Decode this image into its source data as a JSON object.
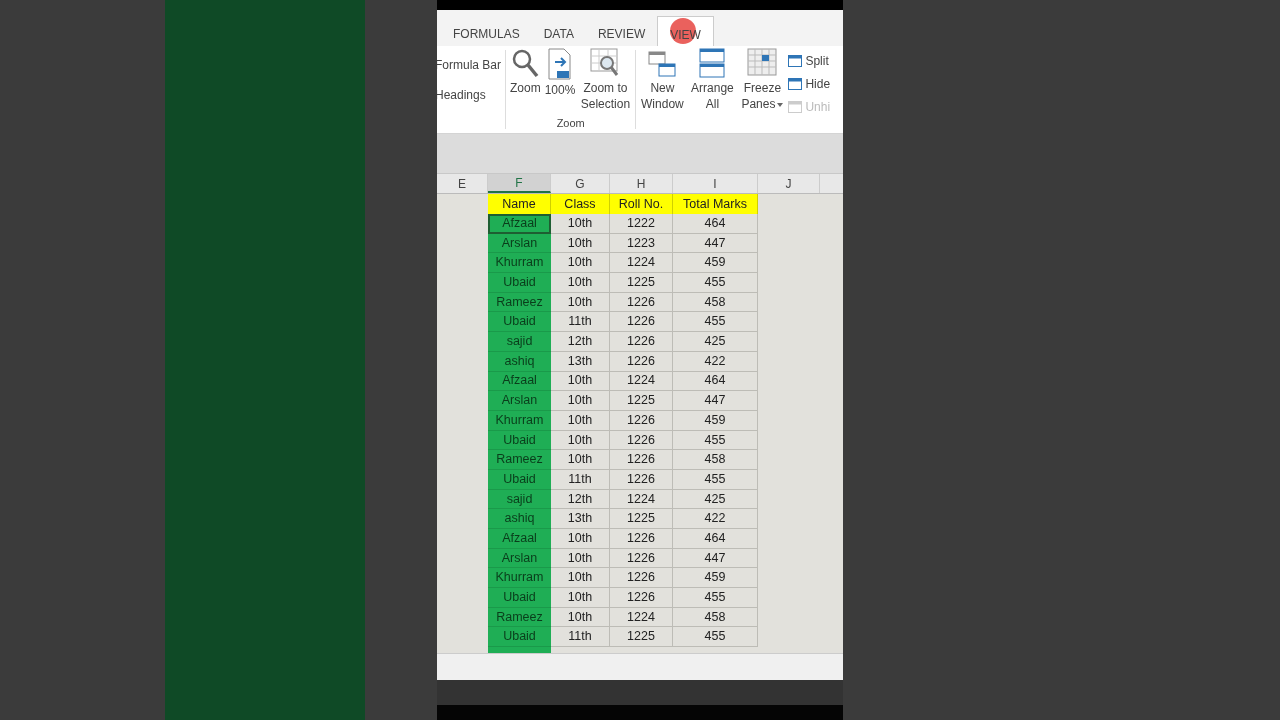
{
  "ribbon_tabs": [
    {
      "label": "FORMULAS",
      "selected": false
    },
    {
      "label": "DATA",
      "selected": false
    },
    {
      "label": "REVIEW",
      "selected": false
    },
    {
      "label": "VIEW",
      "selected": true
    }
  ],
  "show_options": [
    "Formula Bar",
    "Headings"
  ],
  "zoom_group": {
    "buttons": [
      {
        "kind": "zoom",
        "label": "Zoom"
      },
      {
        "kind": "hundred",
        "label": "100%"
      },
      {
        "kind": "selection",
        "label": "Zoom to Selection"
      }
    ],
    "label": "Zoom"
  },
  "window_group": {
    "buttons": [
      {
        "kind": "new",
        "label": "New Window"
      },
      {
        "kind": "arrange",
        "label": "Arrange All"
      },
      {
        "kind": "freeze",
        "label": "Freeze Panes",
        "dropdown": true
      }
    ],
    "small_buttons": [
      {
        "label": "Split",
        "disabled": false
      },
      {
        "label": "Hide",
        "disabled": false
      },
      {
        "label": "Unhi",
        "disabled": true
      }
    ]
  },
  "columns": [
    {
      "label": "E",
      "selected": false
    },
    {
      "label": "F",
      "selected": true
    },
    {
      "label": "G",
      "selected": false
    },
    {
      "label": "H",
      "selected": false
    },
    {
      "label": "I",
      "selected": false
    },
    {
      "label": "J",
      "selected": false
    }
  ],
  "table": {
    "headers": [
      "Name",
      "Class",
      "Roll No.",
      "Total Marks"
    ],
    "rows": [
      {
        "name": "Afzaal",
        "class": "10th",
        "roll": "1222",
        "marks": "464",
        "selected": true
      },
      {
        "name": "Arslan",
        "class": "10th",
        "roll": "1223",
        "marks": "447",
        "selected": false
      },
      {
        "name": "Khurram",
        "class": "10th",
        "roll": "1224",
        "marks": "459",
        "selected": false
      },
      {
        "name": "Ubaid",
        "class": "10th",
        "roll": "1225",
        "marks": "455",
        "selected": false
      },
      {
        "name": "Rameez",
        "class": "10th",
        "roll": "1226",
        "marks": "458",
        "selected": false
      },
      {
        "name": "Ubaid",
        "class": "11th",
        "roll": "1226",
        "marks": "455",
        "selected": false
      },
      {
        "name": "sajid",
        "class": "12th",
        "roll": "1226",
        "marks": "425",
        "selected": false
      },
      {
        "name": "ashiq",
        "class": "13th",
        "roll": "1226",
        "marks": "422",
        "selected": false
      },
      {
        "name": "Afzaal",
        "class": "10th",
        "roll": "1224",
        "marks": "464",
        "selected": false
      },
      {
        "name": "Arslan",
        "class": "10th",
        "roll": "1225",
        "marks": "447",
        "selected": false
      },
      {
        "name": "Khurram",
        "class": "10th",
        "roll": "1226",
        "marks": "459",
        "selected": false
      },
      {
        "name": "Ubaid",
        "class": "10th",
        "roll": "1226",
        "marks": "455",
        "selected": false
      },
      {
        "name": "Rameez",
        "class": "10th",
        "roll": "1226",
        "marks": "458",
        "selected": false
      },
      {
        "name": "Ubaid",
        "class": "11th",
        "roll": "1226",
        "marks": "455",
        "selected": false
      },
      {
        "name": "sajid",
        "class": "12th",
        "roll": "1224",
        "marks": "425",
        "selected": false
      },
      {
        "name": "ashiq",
        "class": "13th",
        "roll": "1225",
        "marks": "422",
        "selected": false
      },
      {
        "name": "Afzaal",
        "class": "10th",
        "roll": "1226",
        "marks": "464",
        "selected": false
      },
      {
        "name": "Arslan",
        "class": "10th",
        "roll": "1226",
        "marks": "447",
        "selected": false
      },
      {
        "name": "Khurram",
        "class": "10th",
        "roll": "1226",
        "marks": "459",
        "selected": false
      },
      {
        "name": "Ubaid",
        "class": "10th",
        "roll": "1226",
        "marks": "455",
        "selected": false
      },
      {
        "name": "Rameez",
        "class": "10th",
        "roll": "1224",
        "marks": "458",
        "selected": false
      },
      {
        "name": "Ubaid",
        "class": "11th",
        "roll": "1225",
        "marks": "455",
        "selected": false
      }
    ]
  }
}
